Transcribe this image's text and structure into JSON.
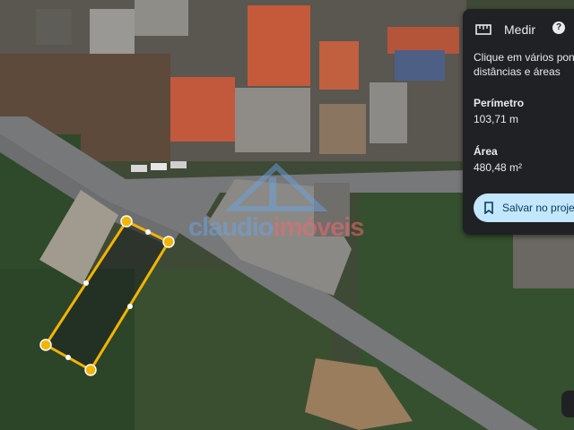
{
  "panel": {
    "title": "Medir",
    "title_icon": "ruler-icon",
    "help_icon": "help-icon",
    "instruction_line1": "Clique em vários pon",
    "instruction_line2": "distâncias e áreas",
    "perimeter_label": "Perímetro",
    "perimeter_value": "103,71 m",
    "area_label": "Área",
    "area_value": "480,48 m²",
    "save_label": "Salvar no proje",
    "save_icon": "bookmark-icon"
  },
  "watermark": {
    "part1": "claudio",
    "part2": "imóveis"
  },
  "colors": {
    "panel_bg": "#202124",
    "panel_text": "#e8eaed",
    "save_button_bg": "#c2e7ff",
    "measure_line": "#f4b400",
    "watermark_blue": "#6aa3e0",
    "watermark_red": "#f06a6a"
  }
}
